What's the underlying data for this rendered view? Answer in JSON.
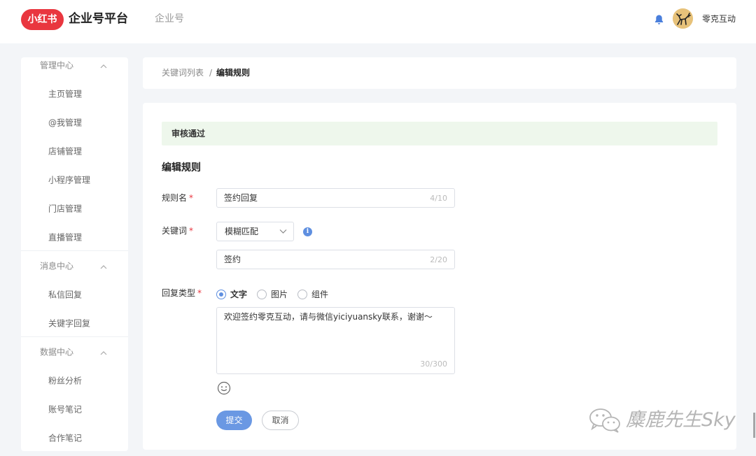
{
  "header": {
    "logo_text": "小红书",
    "brand": "企业号平台",
    "nav_item": "企业号",
    "icons": {
      "bell": "bell-icon",
      "avatar": "avatar"
    },
    "user_name": "零克互动",
    "colors": {
      "logo": "#e9363f",
      "bell": "#4a7fdc"
    }
  },
  "sidebar": {
    "groups": [
      {
        "label": "管理中心",
        "items": [
          "主页管理",
          "@我管理",
          "店铺管理",
          "小程序管理",
          "门店管理",
          "直播管理"
        ]
      },
      {
        "label": "消息中心",
        "items": [
          "私信回复",
          "关键字回复"
        ]
      },
      {
        "label": "数据中心",
        "items": [
          "粉丝分析",
          "账号笔记",
          "合作笔记"
        ]
      }
    ]
  },
  "breadcrumb": {
    "parent": "关键词列表",
    "separator": "/",
    "current": "编辑规则"
  },
  "form": {
    "status": "审核通过",
    "section_title": "编辑规则",
    "required_mark": "*",
    "rule_name": {
      "label": "规则名",
      "value": "签约回复",
      "count": "4/10"
    },
    "keyword": {
      "label": "关键词",
      "match_mode": "模糊匹配",
      "info_icon": "i",
      "value": "签约",
      "count": "2/20"
    },
    "reply_type": {
      "label": "回复类型",
      "options": [
        {
          "label": "文字",
          "checked": true
        },
        {
          "label": "图片",
          "checked": false
        },
        {
          "label": "组件",
          "checked": false
        }
      ]
    },
    "reply_content": {
      "value": "欢迎签约零克互动，请与微信yiciyuansky联系，谢谢～",
      "count": "30/300"
    },
    "submit_label": "提交",
    "cancel_label": "取消",
    "colors": {
      "primary": "#6a98e3",
      "status_bg": "#eef7ec",
      "required": "#e9363f"
    }
  },
  "watermark": {
    "text": "麋鹿先生Sky",
    "icon": "wechat-icon"
  }
}
